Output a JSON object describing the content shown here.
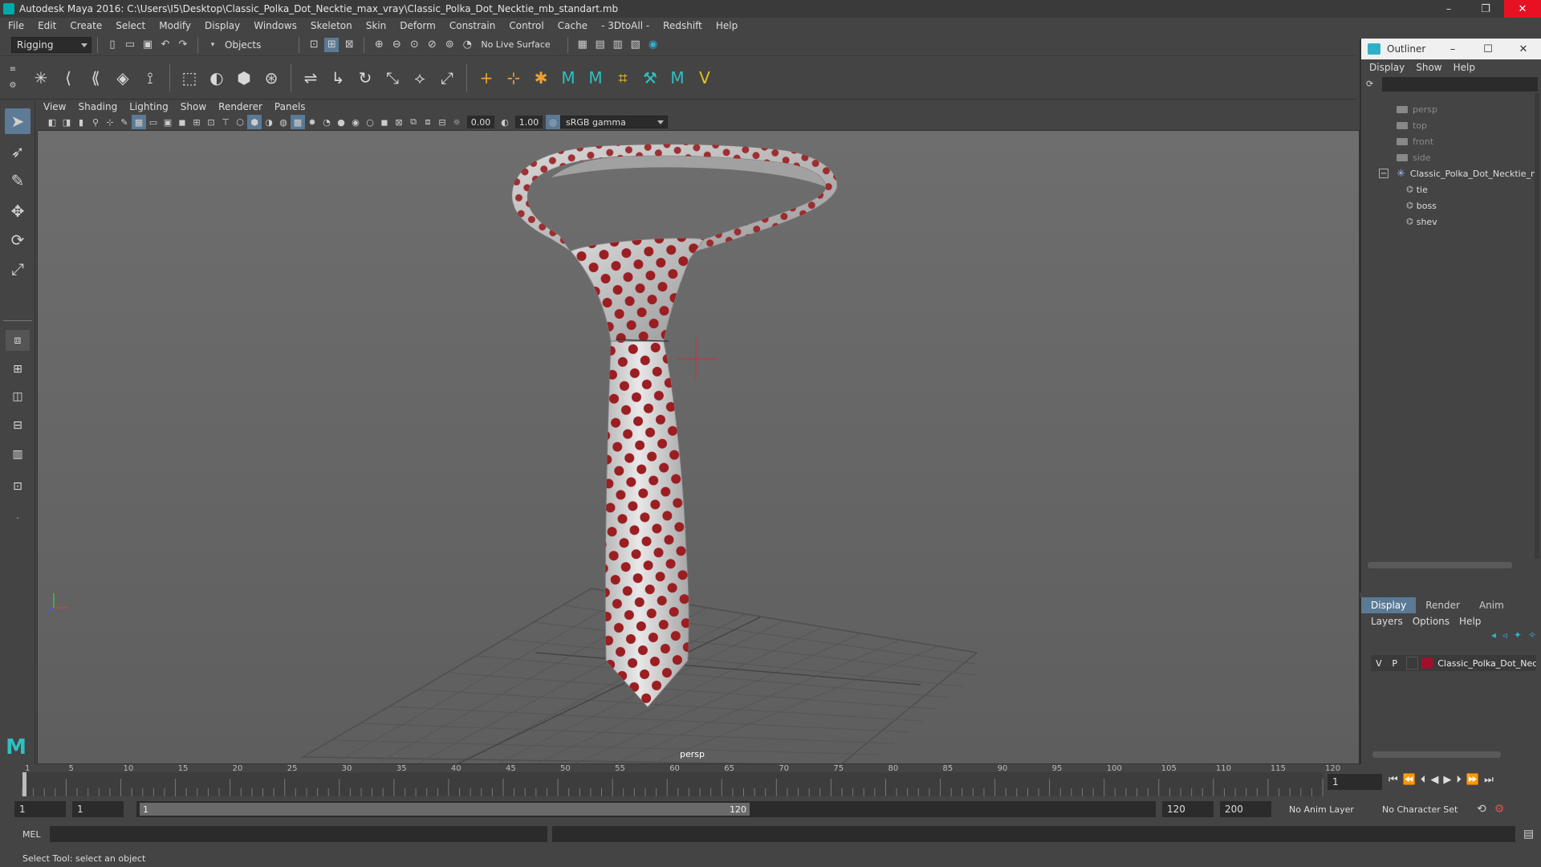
{
  "window": {
    "title": "Autodesk Maya 2016: C:\\Users\\I5\\Desktop\\Classic_Polka_Dot_Necktie_max_vray\\Classic_Polka_Dot_Necktie_mb_standart.mb",
    "minimize": "–",
    "restore": "❐",
    "close": "✕"
  },
  "menubar": [
    "File",
    "Edit",
    "Create",
    "Select",
    "Modify",
    "Display",
    "Windows",
    "Skeleton",
    "Skin",
    "Deform",
    "Constrain",
    "Control",
    "Cache",
    "- 3DtoAll -",
    "Redshift",
    "Help"
  ],
  "statusline": {
    "mode": "Rigging",
    "selection_mode": "Objects",
    "live_surface": "No Live Surface"
  },
  "panel": {
    "menu": [
      "View",
      "Shading",
      "Lighting",
      "Show",
      "Renderer",
      "Panels"
    ],
    "exposure": "0.00",
    "gamma": "1.00",
    "color_space": "sRGB gamma",
    "camera_label": "persp"
  },
  "outliner": {
    "title": "Outliner",
    "menu": [
      "Display",
      "Show",
      "Help"
    ],
    "items": [
      {
        "label": "persp",
        "kind": "camera"
      },
      {
        "label": "top",
        "kind": "camera"
      },
      {
        "label": "front",
        "kind": "camera"
      },
      {
        "label": "side",
        "kind": "camera"
      },
      {
        "label": "Classic_Polka_Dot_Necktie_n",
        "kind": "group"
      },
      {
        "label": "tie",
        "kind": "mesh"
      },
      {
        "label": "boss",
        "kind": "mesh"
      },
      {
        "label": "shev",
        "kind": "mesh"
      }
    ]
  },
  "layers": {
    "tabs": [
      "Display",
      "Render",
      "Anim"
    ],
    "menu": [
      "Layers",
      "Options",
      "Help"
    ],
    "layer": {
      "v": "V",
      "p": "P",
      "name": "Classic_Polka_Dot_Nec",
      "color": "#a0102a"
    }
  },
  "timeline": {
    "ticks": [
      "1",
      "5",
      "10",
      "15",
      "20",
      "25",
      "30",
      "35",
      "40",
      "45",
      "50",
      "55",
      "60",
      "65",
      "70",
      "75",
      "80",
      "85",
      "90",
      "95",
      "100",
      "105",
      "110",
      "115",
      "120"
    ],
    "current_frame": "1"
  },
  "range": {
    "start": "1",
    "inner_start": "1",
    "slider_start": "1",
    "slider_end": "120",
    "end": "120",
    "max": "200",
    "anim_layer": "No Anim Layer",
    "character_set": "No Character Set"
  },
  "cmdline": {
    "label": "MEL"
  },
  "helpline": {
    "text": "Select Tool: select an object"
  },
  "colors": {
    "tie_dot": "#9a1e22",
    "accent": "#5a7a95"
  }
}
